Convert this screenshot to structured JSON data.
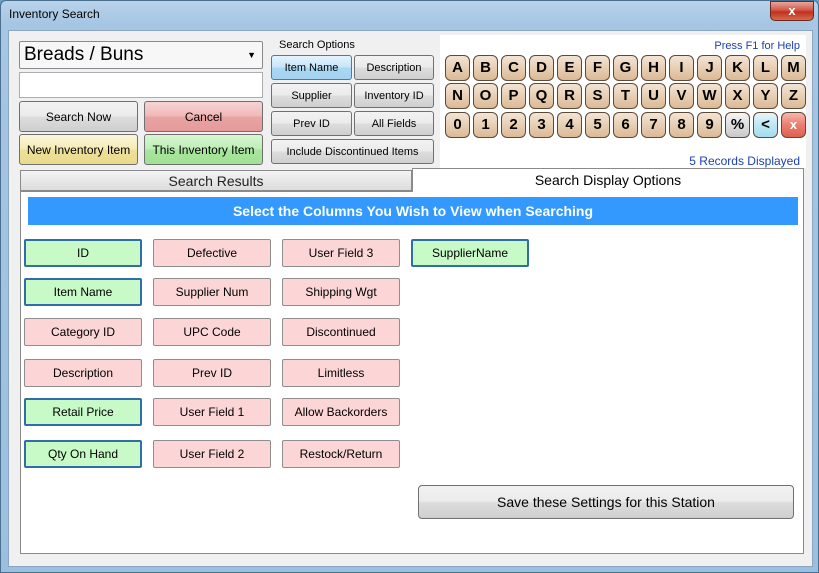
{
  "window": {
    "title": "Inventory Search",
    "close_label": "x"
  },
  "category_dropdown": {
    "value": "Breads / Buns"
  },
  "search_text": {
    "value": ""
  },
  "actions": {
    "search_now": "Search Now",
    "cancel": "Cancel",
    "new_inventory_item": "New Inventory Item",
    "this_inventory_item": "This Inventory Item"
  },
  "search_options": {
    "label": "Search Options",
    "item_name": "Item Name",
    "description": "Description",
    "supplier": "Supplier",
    "inventory_id": "Inventory ID",
    "prev_id": "Prev ID",
    "all_fields": "All Fields",
    "include_discontinued": "Include Discontinued Items"
  },
  "keypad": {
    "help": "Press F1 for Help",
    "records": "5 Records Displayed",
    "row1": [
      "A",
      "B",
      "C",
      "D",
      "E",
      "F",
      "G",
      "H",
      "I",
      "J",
      "K",
      "L",
      "M"
    ],
    "row2": [
      "N",
      "O",
      "P",
      "Q",
      "R",
      "S",
      "T",
      "U",
      "V",
      "W",
      "X",
      "Y",
      "Z"
    ],
    "row3": [
      "0",
      "1",
      "2",
      "3",
      "4",
      "5",
      "6",
      "7",
      "8",
      "9",
      "%",
      "<",
      "x"
    ]
  },
  "tabs": {
    "search_results": "Search Results",
    "search_display_options": "Search Display Options"
  },
  "display_options": {
    "banner": "Select the Columns You Wish to View when Searching",
    "col1": [
      {
        "label": "ID",
        "on": true
      },
      {
        "label": "Item Name",
        "on": true
      },
      {
        "label": "Category ID",
        "on": false
      },
      {
        "label": "Description",
        "on": false
      },
      {
        "label": "Retail Price",
        "on": true
      },
      {
        "label": "Qty On Hand",
        "on": true
      }
    ],
    "col2": [
      {
        "label": "Defective",
        "on": false
      },
      {
        "label": "Supplier Num",
        "on": false
      },
      {
        "label": "UPC Code",
        "on": false
      },
      {
        "label": "Prev ID",
        "on": false
      },
      {
        "label": "User Field 1",
        "on": false
      },
      {
        "label": "User Field 2",
        "on": false
      }
    ],
    "col3": [
      {
        "label": "User Field 3",
        "on": false
      },
      {
        "label": "Shipping Wgt",
        "on": false
      },
      {
        "label": "Discontinued",
        "on": false
      },
      {
        "label": "Limitless",
        "on": false
      },
      {
        "label": "Allow Backorders",
        "on": false
      },
      {
        "label": "Restock/Return",
        "on": false
      }
    ],
    "col4": [
      {
        "label": "SupplierName",
        "on": true
      }
    ],
    "save": "Save these Settings for this Station"
  }
}
